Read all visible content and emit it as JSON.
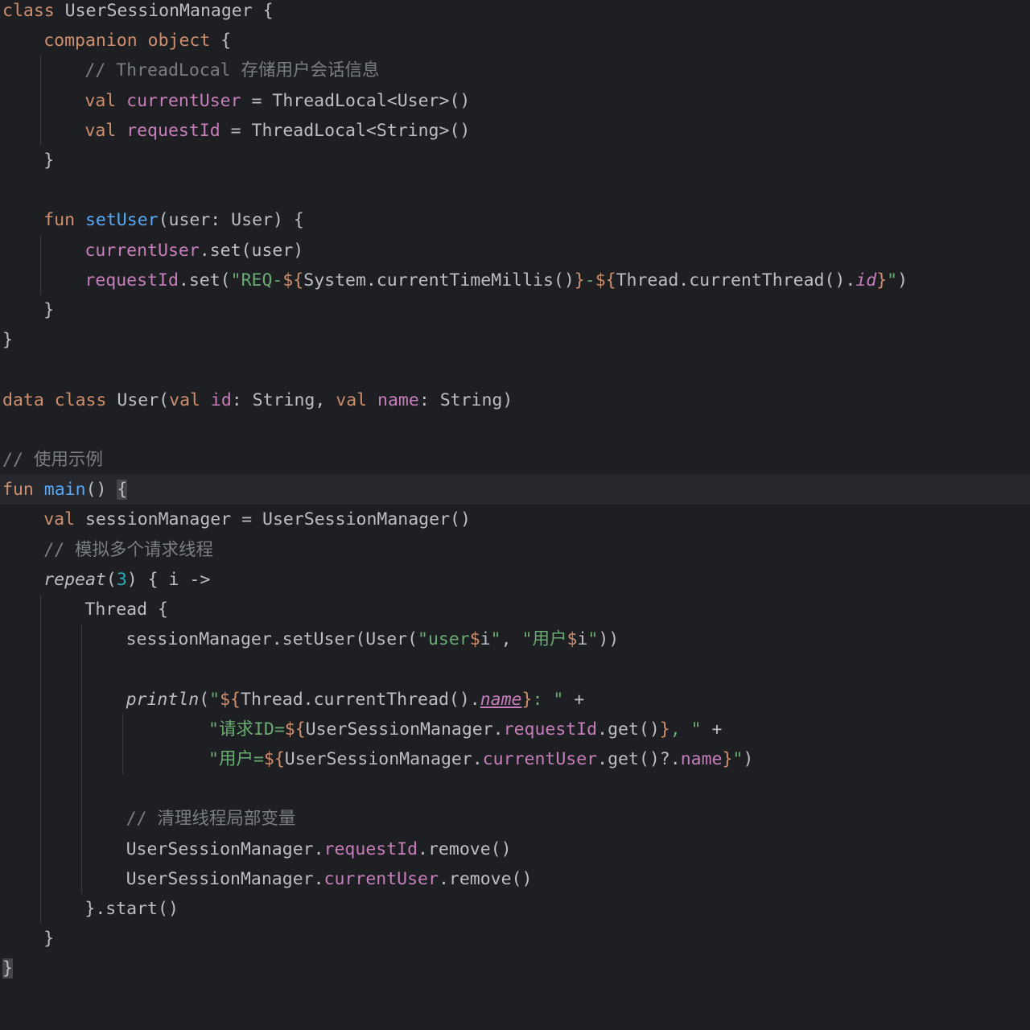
{
  "lines": [
    {
      "n": 0,
      "indent": 0,
      "segs": [
        [
          "class ",
          "kw"
        ],
        [
          "UserSessionManager {",
          ""
        ]
      ]
    },
    {
      "n": 1,
      "indent": 1,
      "segs": [
        [
          "companion object ",
          "kw"
        ],
        [
          "{",
          ""
        ]
      ]
    },
    {
      "n": 2,
      "indent": 2,
      "segs": [
        [
          "// ThreadLocal 存储用户会话信息",
          "cmt"
        ]
      ]
    },
    {
      "n": 3,
      "indent": 2,
      "segs": [
        [
          "val ",
          "kw"
        ],
        [
          "currentUser",
          "prop"
        ],
        [
          " = ThreadLocal<User>()",
          ""
        ]
      ]
    },
    {
      "n": 4,
      "indent": 2,
      "segs": [
        [
          "val ",
          "kw"
        ],
        [
          "requestId",
          "prop"
        ],
        [
          " = ThreadLocal<String>()",
          ""
        ]
      ]
    },
    {
      "n": 5,
      "indent": 1,
      "segs": [
        [
          "}",
          ""
        ]
      ]
    },
    {
      "n": 7,
      "indent": 1,
      "segs": [
        [
          "fun ",
          "kw"
        ],
        [
          "setUser",
          "fn"
        ],
        [
          "(user: User) {",
          ""
        ]
      ]
    },
    {
      "n": 8,
      "indent": 2,
      "segs": [
        [
          "currentUser",
          "prop"
        ],
        [
          ".set(user)",
          ""
        ]
      ]
    },
    {
      "n": 9,
      "indent": 2,
      "segs": [
        [
          "requestId",
          "prop"
        ],
        [
          ".set(",
          ""
        ],
        [
          "\"REQ-",
          "str"
        ],
        [
          "${",
          "kw"
        ],
        [
          "System.currentTimeMillis()",
          ""
        ],
        [
          "}",
          "kw"
        ],
        [
          "-",
          "str"
        ],
        [
          "${",
          "kw"
        ],
        [
          "Thread.currentThread().",
          ""
        ],
        [
          "id",
          "prop it"
        ],
        [
          "}",
          "kw"
        ],
        [
          "\"",
          "str"
        ],
        [
          ")",
          ""
        ]
      ]
    },
    {
      "n": 10,
      "indent": 1,
      "segs": [
        [
          "}",
          ""
        ]
      ]
    },
    {
      "n": 11,
      "indent": 0,
      "segs": [
        [
          "}",
          ""
        ]
      ]
    },
    {
      "n": 13,
      "indent": 0,
      "segs": [
        [
          "data class ",
          "kw"
        ],
        [
          "User(",
          ""
        ],
        [
          "val ",
          "kw"
        ],
        [
          "id",
          "prop"
        ],
        [
          ": String, ",
          ""
        ],
        [
          "val ",
          "kw"
        ],
        [
          "name",
          "prop"
        ],
        [
          ": String)",
          ""
        ]
      ]
    },
    {
      "n": 15,
      "indent": 0,
      "segs": [
        [
          "// 使用示例",
          "cmt"
        ]
      ]
    },
    {
      "n": 16,
      "indent": 0,
      "current": true,
      "segs": [
        [
          "fun ",
          "kw"
        ],
        [
          "main",
          "fn"
        ],
        [
          "() ",
          ""
        ],
        [
          "{",
          "brm"
        ]
      ]
    },
    {
      "n": 17,
      "indent": 1,
      "segs": [
        [
          "val ",
          "kw"
        ],
        [
          "sessionManager = UserSessionManager()",
          ""
        ]
      ]
    },
    {
      "n": 18,
      "indent": 1,
      "segs": [
        [
          "// 模拟多个请求线程",
          "cmt"
        ]
      ]
    },
    {
      "n": 19,
      "indent": 1,
      "segs": [
        [
          "repeat",
          "it"
        ],
        [
          "(",
          ""
        ],
        [
          "3",
          "num"
        ],
        [
          ") { i ->",
          ""
        ]
      ]
    },
    {
      "n": 20,
      "indent": 2,
      "segs": [
        [
          "Thread {",
          ""
        ]
      ]
    },
    {
      "n": 21,
      "indent": 3,
      "segs": [
        [
          "sessionManager.setUser(User(",
          ""
        ],
        [
          "\"user",
          "str"
        ],
        [
          "$",
          "kw"
        ],
        [
          "i",
          ""
        ],
        [
          "\"",
          "str"
        ],
        [
          ", ",
          ""
        ],
        [
          "\"用户",
          "str"
        ],
        [
          "$",
          "kw"
        ],
        [
          "i",
          ""
        ],
        [
          "\"",
          "str"
        ],
        [
          "))",
          ""
        ]
      ]
    },
    {
      "n": 23,
      "indent": 3,
      "segs": [
        [
          "println",
          "it"
        ],
        [
          "(",
          ""
        ],
        [
          "\"",
          "str"
        ],
        [
          "${",
          "kw"
        ],
        [
          "Thread.currentThread().",
          ""
        ],
        [
          "name",
          "prop it ul"
        ],
        [
          "}",
          "kw"
        ],
        [
          ": \"",
          "str"
        ],
        [
          " +",
          ""
        ]
      ]
    },
    {
      "n": 24,
      "indent": 5,
      "segs": [
        [
          "\"请求ID=",
          "str"
        ],
        [
          "${",
          "kw"
        ],
        [
          "UserSessionManager.",
          ""
        ],
        [
          "requestId",
          "prop"
        ],
        [
          ".get()",
          ""
        ],
        [
          "}",
          "kw"
        ],
        [
          ", \"",
          "str"
        ],
        [
          " +",
          ""
        ]
      ]
    },
    {
      "n": 25,
      "indent": 5,
      "segs": [
        [
          "\"用户=",
          "str"
        ],
        [
          "${",
          "kw"
        ],
        [
          "UserSessionManager.",
          ""
        ],
        [
          "currentUser",
          "prop"
        ],
        [
          ".get()?.",
          ""
        ],
        [
          "name",
          "prop"
        ],
        [
          "}",
          "kw"
        ],
        [
          "\"",
          "str"
        ],
        [
          ")",
          ""
        ]
      ]
    },
    {
      "n": 27,
      "indent": 3,
      "segs": [
        [
          "// 清理线程局部变量",
          "cmt"
        ]
      ]
    },
    {
      "n": 28,
      "indent": 3,
      "segs": [
        [
          "UserSessionManager.",
          ""
        ],
        [
          "requestId",
          "prop"
        ],
        [
          ".remove()",
          ""
        ]
      ]
    },
    {
      "n": 29,
      "indent": 3,
      "segs": [
        [
          "UserSessionManager.",
          ""
        ],
        [
          "currentUser",
          "prop"
        ],
        [
          ".remove()",
          ""
        ]
      ]
    },
    {
      "n": 30,
      "indent": 2,
      "segs": [
        [
          "}.start()",
          ""
        ]
      ]
    },
    {
      "n": 31,
      "indent": 1,
      "segs": [
        [
          "}",
          ""
        ]
      ]
    },
    {
      "n": 32,
      "indent": 0,
      "segs": [
        [
          "}",
          "brm"
        ]
      ]
    }
  ],
  "colors": {
    "background": "#1e1f22",
    "current_line": "#26282e",
    "default_text": "#bcbec4",
    "keyword": "#cf8e6d",
    "property": "#c77dbb",
    "function": "#56a8f5",
    "string": "#6aab73",
    "number": "#2aacb8",
    "comment": "#7a7e85"
  }
}
